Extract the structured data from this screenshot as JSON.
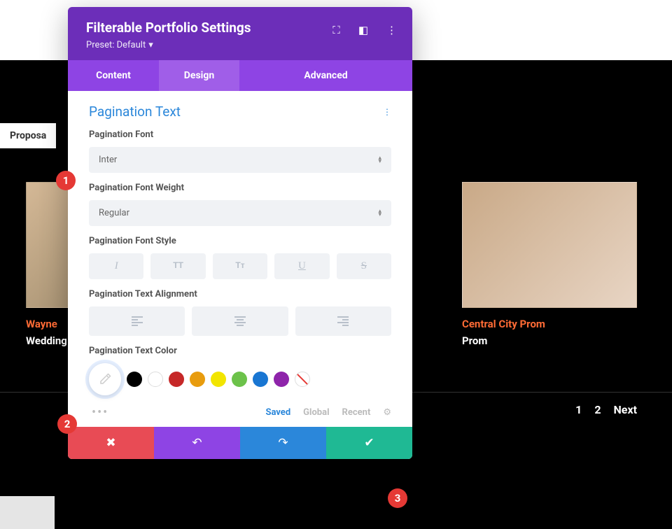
{
  "background": {
    "filter_tab": "Proposa",
    "left_item": {
      "title": "Wayne",
      "category": "Wedding"
    },
    "right_item": {
      "title": "Central City Prom",
      "category": "Prom"
    },
    "pagination": {
      "p1": "1",
      "p2": "2",
      "next": "Next"
    }
  },
  "modal": {
    "title": "Filterable Portfolio Settings",
    "preset_label": "Preset: Default",
    "tabs": {
      "content": "Content",
      "design": "Design",
      "advanced": "Advanced"
    },
    "section_title": "Pagination Text",
    "fields": {
      "font_label": "Pagination Font",
      "font_value": "Inter",
      "weight_label": "Pagination Font Weight",
      "weight_value": "Regular",
      "style_label": "Pagination Font Style",
      "style_buttons": {
        "italic": "I",
        "upper": "TT",
        "smallcaps": "Tᴛ",
        "underline": "U",
        "strike": "S"
      },
      "align_label": "Pagination Text Alignment",
      "color_label": "Pagination Text Color"
    },
    "color_tabs": {
      "saved": "Saved",
      "global": "Global",
      "recent": "Recent"
    }
  },
  "badges": {
    "b1": "1",
    "b2": "2",
    "b3": "3"
  }
}
